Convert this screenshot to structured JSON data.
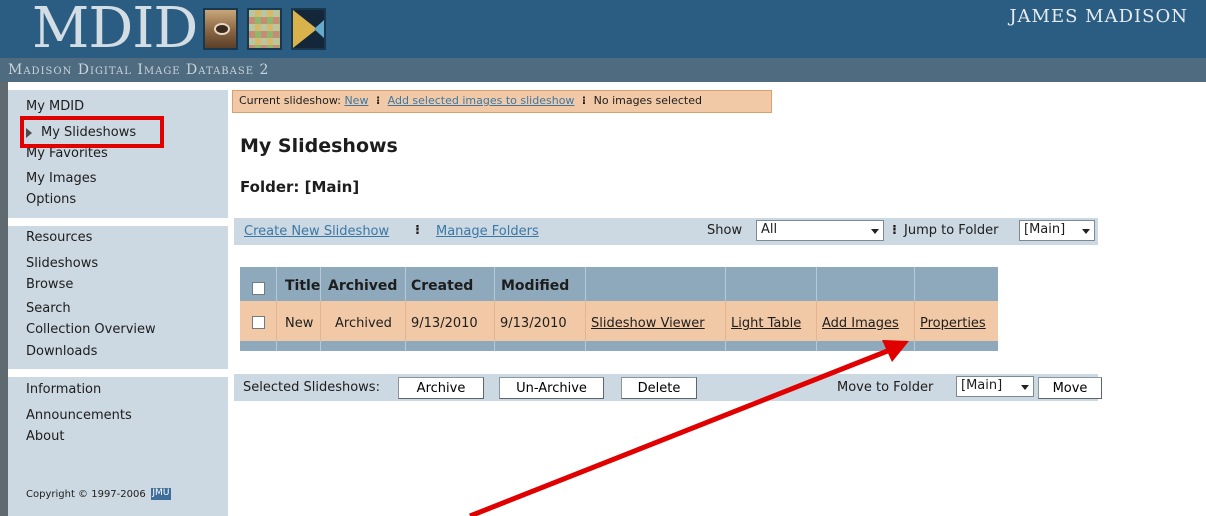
{
  "header": {
    "logo": "MDID",
    "subtitle": "Madison Digital Image Database 2",
    "institution": "JAMES MADISON"
  },
  "sidebar": {
    "sections": [
      {
        "heading": "My MDID",
        "items": [
          "My Slideshows",
          "My Favorites",
          "My Images",
          "Options"
        ]
      },
      {
        "heading": "Resources",
        "items": [
          "Slideshows",
          "Browse",
          "Search",
          "Collection Overview",
          "Downloads"
        ]
      },
      {
        "heading": "Information",
        "items": [
          "Announcements",
          "About"
        ]
      }
    ],
    "copyright": "Copyright © 1997-2006",
    "copyright_logo": "JMU"
  },
  "slideshow_bar": {
    "label": "Current slideshow:",
    "current": "New",
    "add_link": "Add selected images to slideshow",
    "status": "No images selected"
  },
  "main": {
    "title": "My Slideshows",
    "folder": "Folder: [Main]"
  },
  "toolbar": {
    "create_link": "Create New Slideshow",
    "manage_link": "Manage Folders",
    "show_label": "Show",
    "show_value": "All",
    "jump_label": "Jump to Folder",
    "jump_value": "[Main]"
  },
  "table": {
    "headers": [
      "Title",
      "Archived",
      "Created",
      "Modified"
    ],
    "rows": [
      {
        "title": "New",
        "archived": "Archived",
        "created": "9/13/2010",
        "modified": "9/13/2010",
        "actions": [
          "Slideshow Viewer",
          "Light Table",
          "Add Images",
          "Properties"
        ]
      }
    ]
  },
  "actions": {
    "selected_label": "Selected Slideshows:",
    "archive": "Archive",
    "unarchive": "Un-Archive",
    "delete": "Delete",
    "move_label": "Move to Folder",
    "move_value": "[Main]",
    "move": "Move"
  },
  "colors": {
    "header": "#2b5d83",
    "sidebar": "#ccd8e2",
    "highlight_row": "#f2c9a6",
    "table_header": "#8ea8bc",
    "link": "#3c78a5",
    "annotation": "#e00000"
  }
}
